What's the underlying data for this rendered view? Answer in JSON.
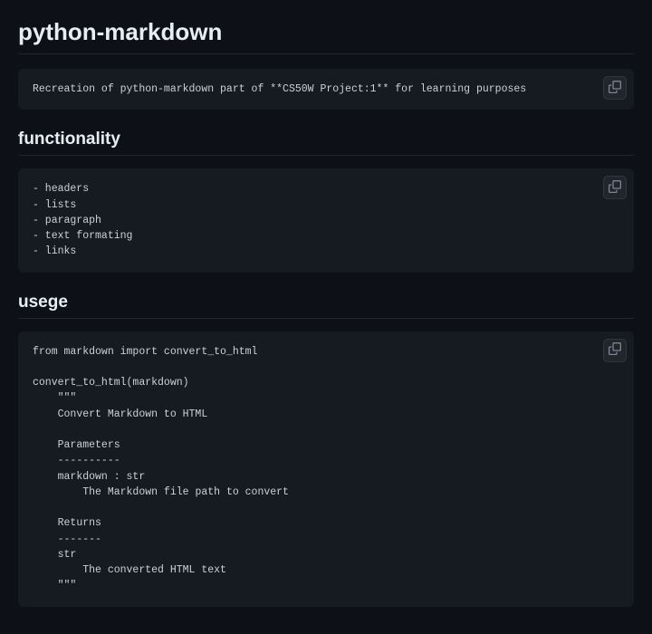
{
  "title": "python-markdown",
  "block1": "Recreation of python-markdown part of **CS50W Project:1** for learning purposes",
  "heading2": "functionality",
  "block2": "- headers\n- lists\n- paragraph\n- text formating\n- links",
  "heading3": "usege",
  "block3": "from markdown import convert_to_html\n\nconvert_to_html(markdown)\n    \"\"\"\n    Convert Markdown to HTML\n\n    Parameters\n    ----------\n    markdown : str\n        The Markdown file path to convert\n\n    Returns\n    -------\n    str\n        The converted HTML text\n    \"\"\""
}
